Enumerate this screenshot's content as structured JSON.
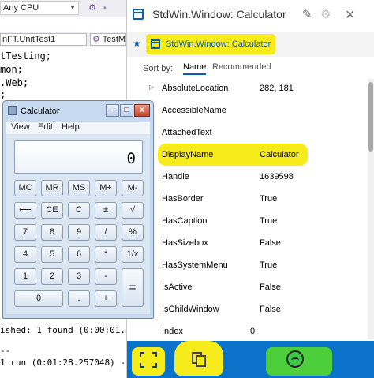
{
  "ide": {
    "platform_combo": "Any CPU",
    "tab_left": "nFT.UnitTest1",
    "tab_right": "TestM",
    "code_lines": [
      "tTesting;",
      "mon;",
      ".Web;",
      ";"
    ],
    "output_lines": [
      "ished: 1 found (0:00:01.31",
      "--",
      "1 run (0:01:28.257048) -"
    ]
  },
  "calculator": {
    "title": "Calculator",
    "caption": {
      "minimize": "–",
      "maximize": "□",
      "close": "x"
    },
    "menu": [
      "View",
      "Edit",
      "Help"
    ],
    "display": "0",
    "keys": {
      "mc": "MC",
      "mr": "MR",
      "ms": "MS",
      "mplus": "M+",
      "mminus": "M-",
      "backspace": "⟵",
      "ce": "CE",
      "c": "C",
      "plusminus": "±",
      "sqrt": "√",
      "d7": "7",
      "d8": "8",
      "d9": "9",
      "divide": "/",
      "percent": "%",
      "d4": "4",
      "d5": "5",
      "d6": "6",
      "multiply": "*",
      "reciprocal": "1/x",
      "d1": "1",
      "d2": "2",
      "d3": "3",
      "minus": "-",
      "equals": "=",
      "d0": "0",
      "decimal": ".",
      "plus": "+"
    }
  },
  "panel": {
    "title": "StdWin.Window: Calculator",
    "icons": {
      "edit": "pencil-icon",
      "settings": "gear-icon",
      "close": "close-icon"
    },
    "breadcrumb": "StdWin.Window: Calculator",
    "sort_label": "Sort by:",
    "sort_tabs": [
      "Name",
      "Recommended"
    ],
    "properties": [
      {
        "name": "AbsoluteLocation",
        "value": "282, 181"
      },
      {
        "name": "AccessibleName",
        "value": ""
      },
      {
        "name": "AttachedText",
        "value": ""
      },
      {
        "name": "DisplayName",
        "value": "Calculator"
      },
      {
        "name": "Handle",
        "value": "1639598"
      },
      {
        "name": "HasBorder",
        "value": "True"
      },
      {
        "name": "HasCaption",
        "value": "True"
      },
      {
        "name": "HasSizebox",
        "value": "False"
      },
      {
        "name": "HasSystemMenu",
        "value": "True"
      },
      {
        "name": "IsActive",
        "value": "False"
      },
      {
        "name": "IsChildWindow",
        "value": "False"
      },
      {
        "name": "Index",
        "value": "0"
      }
    ],
    "bottom_bar_color": "#0a72c9",
    "highlight_color": "#f6ec1b"
  }
}
